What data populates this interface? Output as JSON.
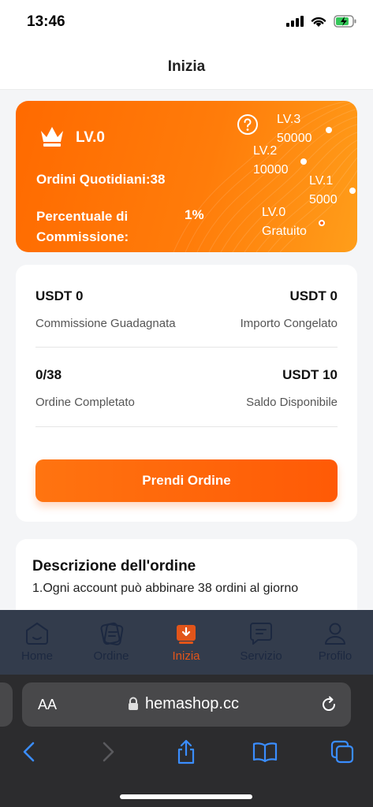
{
  "status": {
    "time": "13:46"
  },
  "header": {
    "title": "Inizia"
  },
  "level_card": {
    "level": "LV.0",
    "daily_orders": "Ordini Quotidiani:38",
    "commission_label": "Percentuale di Commissione:",
    "commission_value": "1%",
    "tiers": [
      {
        "name": "LV.3",
        "price": "50000"
      },
      {
        "name": "LV.2",
        "price": "10000"
      },
      {
        "name": "LV.1",
        "price": "5000"
      },
      {
        "name": "LV.0",
        "price": "Gratuito"
      }
    ]
  },
  "stats": {
    "commission_earned": {
      "value": "USDT 0",
      "label": "Commissione Guadagnata"
    },
    "frozen_amount": {
      "value": "USDT 0",
      "label": "Importo Congelato"
    },
    "completed_orders": {
      "value": "0/38",
      "label": "Ordine Completato"
    },
    "available_balance": {
      "value": "USDT 10",
      "label": "Saldo Disponibile"
    },
    "take_order_label": "Prendi Ordine"
  },
  "description": {
    "title": "Descrizione dell'ordine",
    "line1": "1.Ogni account può abbinare 38 ordini al giorno"
  },
  "tabs": [
    {
      "label": "Home",
      "icon": "home-icon"
    },
    {
      "label": "Ordine",
      "icon": "order-icon"
    },
    {
      "label": "Inizia",
      "icon": "start-icon",
      "active": true
    },
    {
      "label": "Servizio",
      "icon": "chat-icon"
    },
    {
      "label": "Profilo",
      "icon": "profile-icon"
    }
  ],
  "browser": {
    "text_size": "AA",
    "url": "hemashop.cc"
  },
  "colors": {
    "accent": "#ff6a00",
    "tab_active": "#e2551a",
    "tab_bar": "#333c4c"
  }
}
